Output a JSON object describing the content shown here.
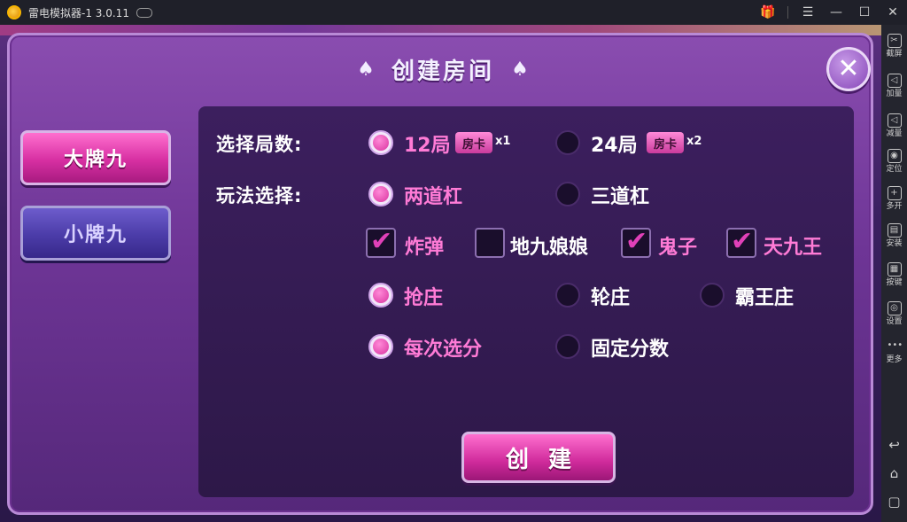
{
  "window": {
    "title": "雷电模拟器-1 3.0.11",
    "controls": {
      "menu": "☰",
      "minimize": "—",
      "maximize": "☐",
      "close": "✕"
    }
  },
  "sidebar": {
    "items": [
      {
        "icon": "scissors-icon",
        "glyph": "✂",
        "label": "截屏"
      },
      {
        "icon": "volume-up-icon",
        "glyph": "◁",
        "label": "加量"
      },
      {
        "icon": "volume-down-icon",
        "glyph": "◁",
        "label": "减量"
      },
      {
        "icon": "location-icon",
        "glyph": "◉",
        "label": "定位"
      },
      {
        "icon": "multi-open-icon",
        "glyph": "+",
        "label": "多开"
      },
      {
        "icon": "apk-install-icon",
        "glyph": "▤",
        "label": "安装"
      },
      {
        "icon": "keyboard-icon",
        "glyph": "▦",
        "label": "按键"
      },
      {
        "icon": "settings-icon",
        "glyph": "◎",
        "label": "设置"
      },
      {
        "icon": "more-icon",
        "glyph": "•••",
        "label": "更多"
      }
    ],
    "nav": {
      "back": "↩",
      "home": "⌂",
      "recent": "▢"
    }
  },
  "dialog": {
    "title": "创建房间",
    "spade": "♠",
    "close": "✕",
    "mode_tabs": [
      {
        "label": "大牌九",
        "active": true
      },
      {
        "label": "小牌九",
        "active": false
      }
    ],
    "rounds": {
      "label": "选择局数:",
      "options": [
        {
          "label": "12局",
          "selected": true,
          "badge": "房卡",
          "mult": "x1"
        },
        {
          "label": "24局",
          "selected": false,
          "badge": "房卡",
          "mult": "x2"
        }
      ]
    },
    "play": {
      "label": "玩法选择:",
      "bars": [
        {
          "label": "两道杠",
          "selected": true
        },
        {
          "label": "三道杠",
          "selected": false
        }
      ],
      "extras": [
        {
          "label": "炸弹",
          "checked": true
        },
        {
          "label": "地九娘娘",
          "checked": false
        },
        {
          "label": "鬼子",
          "checked": true
        },
        {
          "label": "天九王",
          "checked": true
        }
      ],
      "banker": [
        {
          "label": "抢庄",
          "selected": true
        },
        {
          "label": "轮庄",
          "selected": false
        },
        {
          "label": "霸王庄",
          "selected": false
        }
      ],
      "score": [
        {
          "label": "每次选分",
          "selected": true
        },
        {
          "label": "固定分数",
          "selected": false
        }
      ]
    },
    "create_button": "创建",
    "check_glyph": "✔"
  }
}
